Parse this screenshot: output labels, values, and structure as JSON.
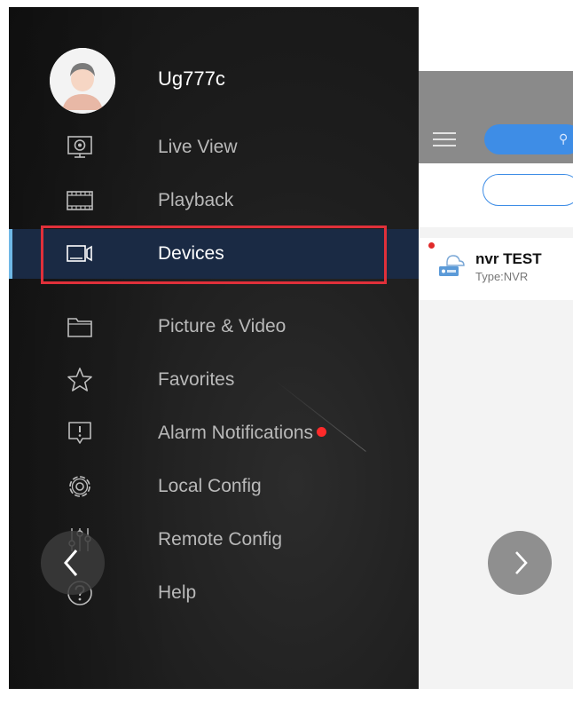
{
  "user": {
    "name": "Ug777c"
  },
  "menu": {
    "items": [
      {
        "label": "Live View",
        "icon": "live-view-icon"
      },
      {
        "label": "Playback",
        "icon": "playback-icon"
      },
      {
        "label": "Devices",
        "icon": "devices-icon",
        "active": true
      },
      {
        "label": "Picture & Video",
        "icon": "folder-icon"
      },
      {
        "label": "Favorites",
        "icon": "star-icon"
      },
      {
        "label": "Alarm Notifications",
        "icon": "alarm-icon",
        "badge": true
      },
      {
        "label": "Local Config",
        "icon": "gear-icon"
      },
      {
        "label": "Remote Config",
        "icon": "sliders-icon"
      },
      {
        "label": "Help",
        "icon": "help-icon"
      }
    ]
  },
  "device_list": {
    "devices": [
      {
        "name": "nvr TEST",
        "type": "Type:NVR"
      }
    ]
  },
  "colors": {
    "drawer_bg": "#1e1e1e",
    "active_item_bg": "#1a2a44",
    "active_bar": "#6fb8e6",
    "highlight_border": "#e0303a",
    "badge": "#ff2a2a",
    "accent_blue": "#3e8de6"
  }
}
